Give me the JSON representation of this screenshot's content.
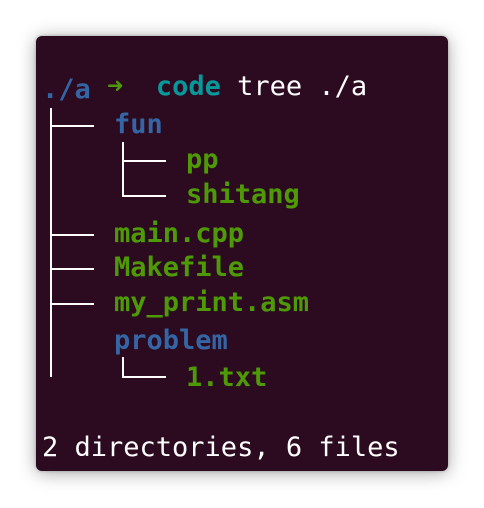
{
  "prompt": {
    "arrow": "➜",
    "cwd": "code",
    "command": "tree ./a"
  },
  "tree": {
    "root": "./a",
    "entries": [
      {
        "name": "fun",
        "kind": "directory"
      },
      {
        "name": "pp",
        "kind": "file"
      },
      {
        "name": "shitang",
        "kind": "file"
      },
      {
        "name": "main.cpp",
        "kind": "file"
      },
      {
        "name": "Makefile",
        "kind": "file"
      },
      {
        "name": "my_print.asm",
        "kind": "file"
      },
      {
        "name": "problem",
        "kind": "directory"
      },
      {
        "name": "1.txt",
        "kind": "file"
      }
    ]
  },
  "summary": "2 directories, 6 files",
  "colors": {
    "background": "#2c0a1f",
    "prompt_arrow": "#4e9a06",
    "cwd": "#06989a",
    "directory": "#3465a4",
    "file": "#4e9a06",
    "text": "#ffffff"
  }
}
